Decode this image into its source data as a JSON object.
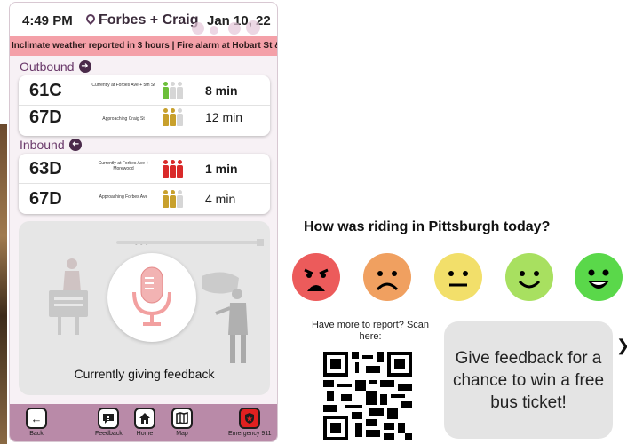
{
  "status_bar": {
    "time": "4:49 PM",
    "location": "Forbes + Craig",
    "date": "Jan 10, 22"
  },
  "alert_ticker": "Inclimate weather reported in 3 hours | Fire alarm at Hobart St &",
  "outbound": {
    "label": "Outbound",
    "routes": [
      {
        "route": "61C",
        "status": "Currently at Forbes Ave + 5th St",
        "crowd_level": 1,
        "crowd_color": "#6cbf3a",
        "eta": "8 min"
      },
      {
        "route": "67D",
        "status": "Approaching Craig St",
        "crowd_level": 2,
        "crowd_color": "#c8a02c",
        "eta": "12 min"
      }
    ]
  },
  "inbound": {
    "label": "Inbound",
    "routes": [
      {
        "route": "63D",
        "status": "Currently at Forbes Ave + Morewood",
        "crowd_level": 3,
        "crowd_color": "#d92a2a",
        "eta": "1 min"
      },
      {
        "route": "67D",
        "status": "Approaching Forbes Ave",
        "crowd_level": 2,
        "crowd_color": "#c8a02c",
        "eta": "4 min"
      }
    ]
  },
  "feedback": {
    "status_label": "Currently giving feedback"
  },
  "bottom_nav": [
    {
      "label": "Back",
      "icon": "back-arrow-icon"
    },
    {
      "label": "Feedback",
      "icon": "speech-bubble-icon"
    },
    {
      "label": "Home",
      "icon": "home-icon"
    },
    {
      "label": "Map",
      "icon": "map-icon"
    },
    {
      "label": "Emergency 911",
      "icon": "emergency-shield-icon"
    }
  ],
  "survey": {
    "question": "How was riding in Pittsburgh today?",
    "faces": [
      {
        "mood": "very-bad",
        "color": "#ec5b5b"
      },
      {
        "mood": "bad",
        "color": "#f0a060"
      },
      {
        "mood": "neutral",
        "color": "#f2df6a"
      },
      {
        "mood": "good",
        "color": "#a8e060"
      },
      {
        "mood": "very-good",
        "color": "#5ad84a"
      }
    ],
    "report_prompt": "Have more to report? Scan here:",
    "cta": "Give feedback for a chance to win a free bus ticket!"
  },
  "colors": {
    "ticker_bg": "#f4a0a8",
    "nav_bg": "#b98aa8",
    "accent_text": "#6b3a6b"
  }
}
